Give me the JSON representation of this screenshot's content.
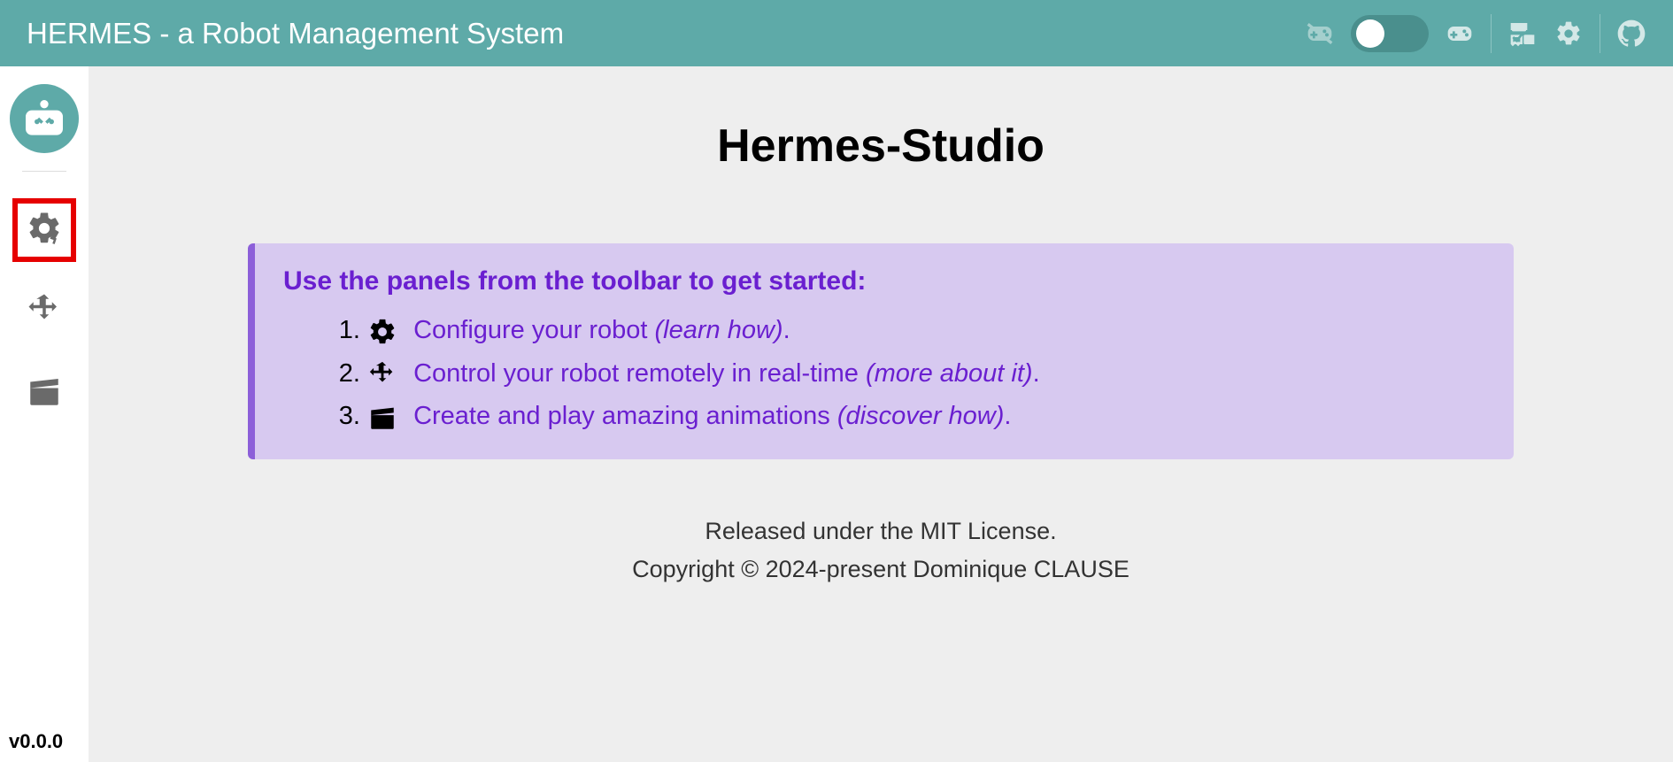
{
  "header": {
    "title": "HERMES - a Robot Management System"
  },
  "sidebar": {
    "version": "v0.0.0"
  },
  "main": {
    "title": "Hermes-Studio",
    "info_title": "Use the panels from the toolbar to get started:",
    "steps": [
      {
        "text": "Configure your robot",
        "learn": "(learn how)",
        "punct": "."
      },
      {
        "text": "Control your robot remotely in real-time",
        "learn": "(more about it)",
        "punct": "."
      },
      {
        "text": "Create and play amazing animations",
        "learn": "(discover how)",
        "punct": "."
      }
    ],
    "footer_license": "Released under the MIT License.",
    "footer_copyright": "Copyright © 2024-present Dominique CLAUSE"
  }
}
